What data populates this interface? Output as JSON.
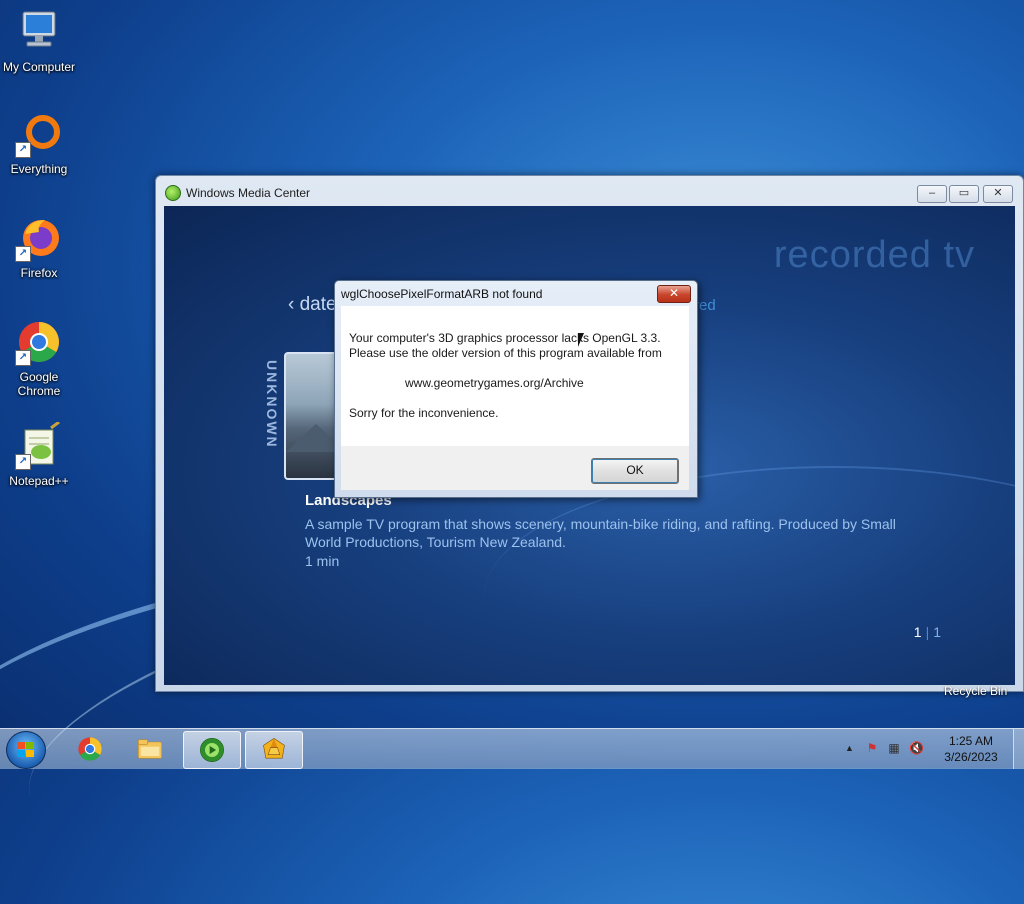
{
  "desktop": {
    "icons": [
      {
        "label": "My Computer"
      },
      {
        "label": "Everything"
      },
      {
        "label": "Firefox"
      },
      {
        "label": "Google Chrome"
      },
      {
        "label": "Notepad++"
      }
    ],
    "recycle_bin_label": "Recycle Bin"
  },
  "wmc_window": {
    "title": "Windows Media Center",
    "buttons": {
      "minimize": "–",
      "maximize": "▭",
      "close": "✕"
    },
    "heading": "recorded tv",
    "nav_left": "‹ date",
    "nav_right": "red",
    "genre_label": "UNKNOWN",
    "program": {
      "title": "Landscapes",
      "description": "A sample TV program that shows scenery, mountain-bike riding, and rafting. Produced by Small World Productions, Tourism New Zealand.",
      "duration": "1 min"
    },
    "pager": {
      "current": "1",
      "total": "1"
    }
  },
  "dialog": {
    "title": "wglChoosePixelFormatARB not found",
    "line1": "Your computer's 3D graphics processor lacks OpenGL 3.3.",
    "line2": "Please use the older version of this program available from",
    "url": "www.geometrygames.org/Archive",
    "line3": "Sorry for the inconvenience.",
    "ok_label": "OK",
    "close_glyph": "✕"
  },
  "taskbar": {
    "clock": {
      "time": "1:25 AM",
      "date": "3/26/2023"
    },
    "tray_up_glyph": "▲"
  },
  "colors": {
    "accent": "#3f8fd8",
    "desktop_blue": "#1c63b8"
  }
}
